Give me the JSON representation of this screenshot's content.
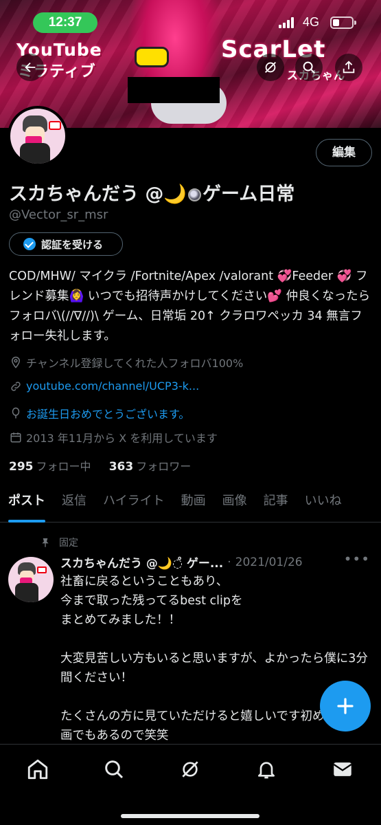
{
  "status_bar": {
    "time": "12:37",
    "network": "4G"
  },
  "banner": {
    "text_left_1": "YouTube",
    "text_left_2": "ミラティブ",
    "text_right_1": "ScarLet",
    "text_right_2": "スカちゃん"
  },
  "profile": {
    "edit_label": "編集",
    "display_name_part1": "スカちゃんだう @",
    "display_name_moon": "🌙",
    "display_name_part2": "ゲーム日常",
    "handle": "@Vector_sr_msr",
    "verify_label": "認証を受ける",
    "bio": "COD/MHW/ マイクラ /Fortnite/Apex /valorant 💞Feeder 💞 フレンド募集🙆‍♀️ いつでも招待声かけしてください💕 仲良くなったらフォロバ\\(//∇//)\\ ゲーム、日常垢 20↑ クラロワペッカ 34 無言フォロー失礼します。",
    "location": "チャンネル登録してくれた人フォロバ100%",
    "link": "youtube.com/channel/UCP3-k...",
    "birthday": "お誕生日おめでとうございます。",
    "joined": "2013 年11月から X を利用しています",
    "following_count": "295",
    "following_label": "フォロー中",
    "followers_count": "363",
    "followers_label": "フォロワー"
  },
  "tabs": [
    {
      "label": "ポスト"
    },
    {
      "label": "返信"
    },
    {
      "label": "ハイライト"
    },
    {
      "label": "動画"
    },
    {
      "label": "画像"
    },
    {
      "label": "記事"
    },
    {
      "label": "いいね"
    }
  ],
  "pinned_post": {
    "pinned_label": "固定",
    "author": "スカちゃんだう @🌙◌̊ ゲー...",
    "separator": "·",
    "date": "2021/01/26",
    "more": "•••",
    "body": "社畜に戻るということもあり、\n今まで取った残ってるbest clipを\nまとめてみました！！\n\n大変見苦しい方もいると思いますが、よかったら僕に3分間ください！\n\nたくさんの方に見ていただけると嬉しいです初めての動画でもあるので笑笑"
  },
  "colors": {
    "accent": "#1d9bf0",
    "background": "#000000",
    "secondary_text": "#71767b",
    "status_pill": "#34c759"
  },
  "icons": {
    "back": "arrow-left-icon",
    "grok": "grok-icon",
    "search": "search-icon",
    "share": "share-icon",
    "location": "location-pin-icon",
    "link": "link-icon",
    "birthday": "balloon-icon",
    "joined": "calendar-icon",
    "pin": "pin-icon",
    "compose": "plus-icon",
    "nav": [
      "home-icon",
      "search-icon",
      "grok-icon",
      "bell-icon",
      "mail-icon"
    ]
  }
}
